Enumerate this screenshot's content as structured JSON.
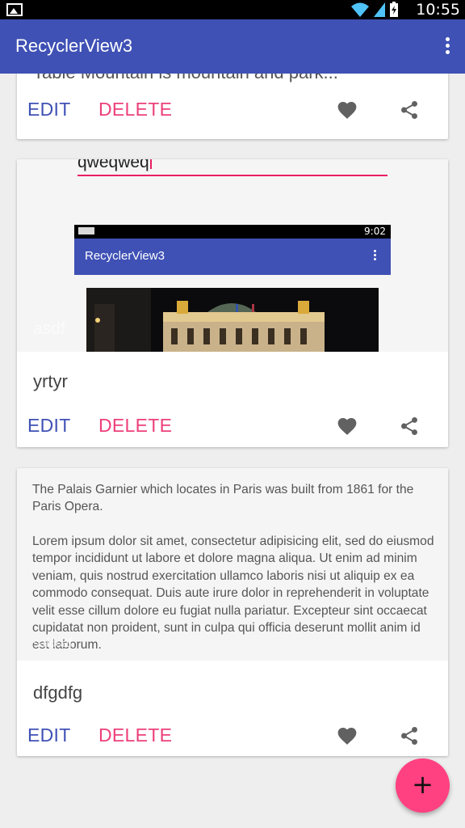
{
  "status_bar": {
    "time": "10:55"
  },
  "app_bar": {
    "title": "RecyclerView3",
    "menu_icon": "more-vert-icon"
  },
  "cards": [
    {
      "description": "Table Mountain is mountain and park...",
      "edit_label": "EDIT",
      "delete_label": "DELETE"
    },
    {
      "typed_text": "qweqweq",
      "screenshot_title": "RecyclerView3",
      "screenshot_time": "9:02",
      "overlay_text": "asdf",
      "title": "yrtyr",
      "edit_label": "EDIT",
      "delete_label": "DELETE"
    },
    {
      "paragraph1": "The Palais Garnier which locates in Paris was built from 1861 for the Paris Opera.",
      "paragraph2": "Lorem ipsum dolor sit amet, consectetur adipisicing elit, sed do eiusmod tempor incididunt ut labore et dolore magna aliqua. Ut enim ad minim veniam, quis nostrud exercitation ullamco laboris nisi ut aliquip ex ea commodo consequat. Duis aute irure dolor in reprehenderit in voluptate velit esse cillum dolore eu fugiat nulla pariatur. Excepteur sint occaecat cupidatat non proident, sunt in culpa qui officia deserunt mollit anim id est laborum.",
      "overlay_text": "safdsaf",
      "title": "dfgdfg",
      "edit_label": "EDIT",
      "delete_label": "DELETE"
    }
  ],
  "fab": {
    "label": "+"
  },
  "colors": {
    "primary": "#3f51b5",
    "accent": "#ec407a",
    "fab": "#ff4081"
  }
}
